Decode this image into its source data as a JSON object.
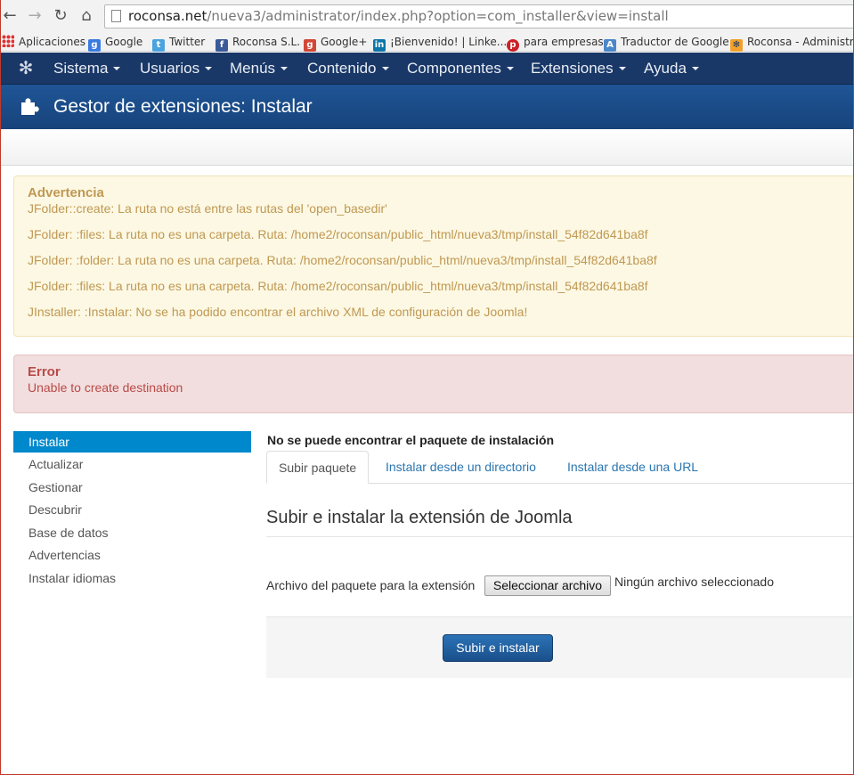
{
  "browser": {
    "url_domain": "roconsa.net",
    "url_path": "/nueva3/administrator/index.php?option=com_installer&view=install",
    "bookmarks": [
      {
        "label": "Aplicaciones",
        "icon": "apps-grid-icon"
      },
      {
        "label": "Google",
        "icon": "google-icon"
      },
      {
        "label": "Twitter",
        "icon": "twitter-icon"
      },
      {
        "label": "Roconsa S.L.",
        "icon": "facebook-icon"
      },
      {
        "label": "Google+",
        "icon": "google-plus-icon"
      },
      {
        "label": "¡Bienvenido! | Linke...",
        "icon": "linkedin-icon"
      },
      {
        "label": "para empresas",
        "icon": "pinterest-icon"
      },
      {
        "label": "Traductor de Google",
        "icon": "translate-icon"
      },
      {
        "label": "Roconsa - Administr...",
        "icon": "joomla-icon"
      }
    ]
  },
  "menu": {
    "items": [
      "Sistema",
      "Usuarios",
      "Menús",
      "Contenido",
      "Componentes",
      "Extensiones",
      "Ayuda"
    ]
  },
  "header": {
    "title": "Gestor de extensiones: Instalar"
  },
  "warning": {
    "heading": "Advertencia",
    "lines": [
      "JFolder::create: La ruta no está entre las rutas del 'open_basedir'",
      "JFolder: :files: La ruta no es una carpeta. Ruta: /home2/roconsan/public_html/nueva3/tmp/install_54f82d641ba8f",
      "JFolder: :folder: La ruta no es una carpeta. Ruta: /home2/roconsan/public_html/nueva3/tmp/install_54f82d641ba8f",
      "JFolder: :files: La ruta no es una carpeta. Ruta: /home2/roconsan/public_html/nueva3/tmp/install_54f82d641ba8f",
      "JInstaller: :Instalar: No se ha podido encontrar el archivo XML de configuración de Joomla!"
    ]
  },
  "error": {
    "heading": "Error",
    "message": "Unable to create destination"
  },
  "sidebar": {
    "items": [
      "Instalar",
      "Actualizar",
      "Gestionar",
      "Descubrir",
      "Base de datos",
      "Advertencias",
      "Instalar idiomas"
    ],
    "active": "Instalar"
  },
  "main": {
    "notice": "No se puede encontrar el paquete de instalación",
    "tabs": [
      "Subir paquete",
      "Instalar desde un directorio",
      "Instalar desde una URL"
    ],
    "section_title": "Subir e instalar la extensión de Joomla",
    "file_label": "Archivo del paquete para la extensión",
    "file_button": "Seleccionar archivo",
    "file_status": "Ningún archivo seleccionado",
    "submit_label": "Subir e instalar"
  },
  "colors": {
    "nav_bg": "#1a3867",
    "header_bg": "#17437b",
    "warning_text": "#c09853",
    "error_text": "#b94a48",
    "active_sidebar": "#0088cc",
    "link": "#2a76b0"
  }
}
